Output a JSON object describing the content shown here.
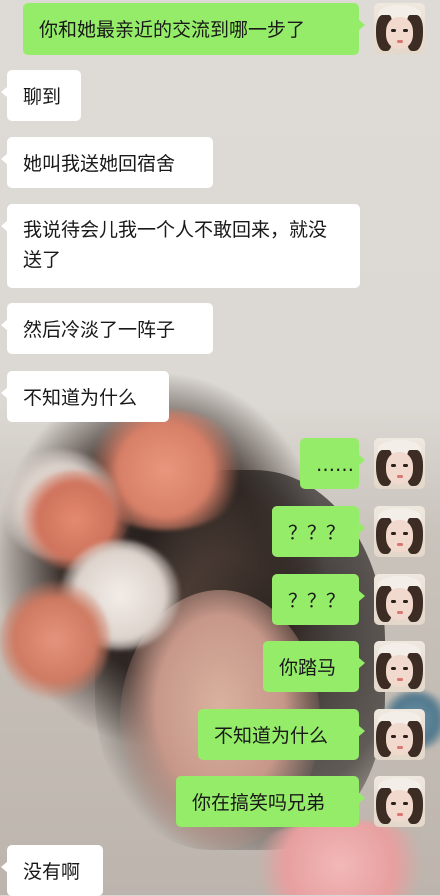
{
  "messages": [
    {
      "side": "out",
      "text": "你和她最亲近的交流到哪一步了"
    },
    {
      "side": "in",
      "text": "聊到"
    },
    {
      "side": "in",
      "text": "她叫我送她回宿舍"
    },
    {
      "side": "in",
      "text": "我说待会儿我一个人不敢回来，就没送了"
    },
    {
      "side": "in",
      "text": "然后冷淡了一阵子"
    },
    {
      "side": "in",
      "text": "不知道为什么"
    },
    {
      "side": "out",
      "text": "……"
    },
    {
      "side": "out",
      "text": "？？？"
    },
    {
      "side": "out",
      "text": "？？？"
    },
    {
      "side": "out",
      "text": "你踏马"
    },
    {
      "side": "out",
      "text": "不知道为什么"
    },
    {
      "side": "out",
      "text": "你在搞笑吗兄弟"
    },
    {
      "side": "in",
      "text": "没有啊"
    }
  ],
  "colors": {
    "outgoing": "#95ec69",
    "incoming": "#ffffff",
    "text": "#191919"
  },
  "icons": {
    "avatar": "user-avatar-girl-with-cap"
  }
}
